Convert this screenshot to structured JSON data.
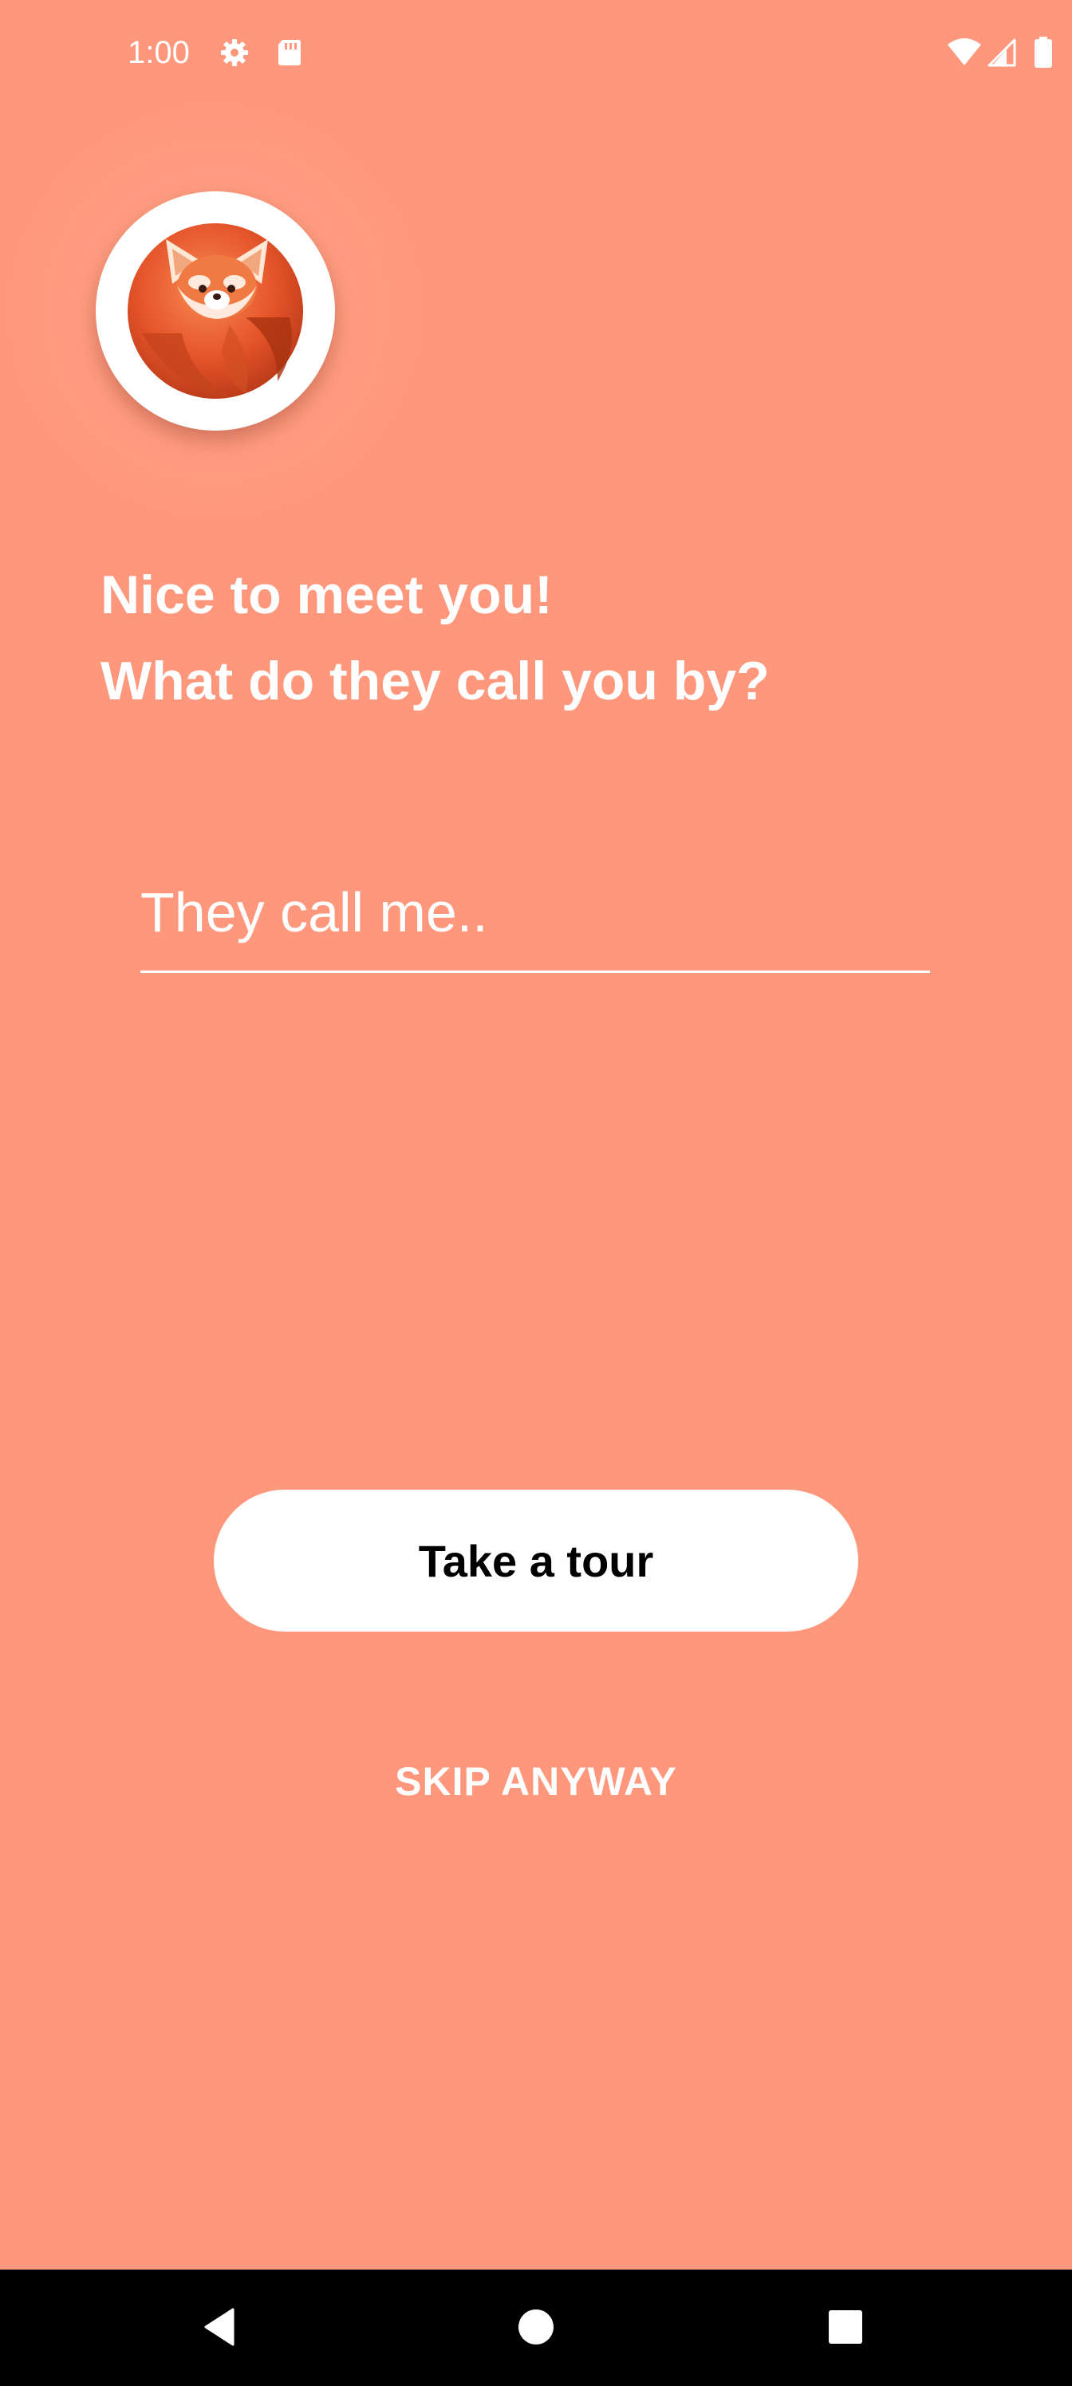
{
  "status_bar": {
    "time": "1:00",
    "icons_left": [
      "gear-icon",
      "sd-card-icon"
    ],
    "icons_right": [
      "wifi-icon",
      "cell-signal-icon",
      "battery-icon"
    ]
  },
  "colors": {
    "background": "#FF977C",
    "text": "#FFFFFF",
    "button_background": "#FFFFFF",
    "button_text": "#000000",
    "nav_bar": "#000000"
  },
  "logo": {
    "icon": "red-panda-icon"
  },
  "headline": {
    "line1": "Nice to meet you!",
    "line2": "What do they call you by?"
  },
  "name_input": {
    "value": "",
    "placeholder": "They call me.."
  },
  "actions": {
    "tour_label": "Take a tour",
    "skip_label": "SKIP ANYWAY"
  },
  "nav_bar": {
    "icons": [
      "back-icon",
      "home-icon",
      "recents-icon"
    ]
  }
}
